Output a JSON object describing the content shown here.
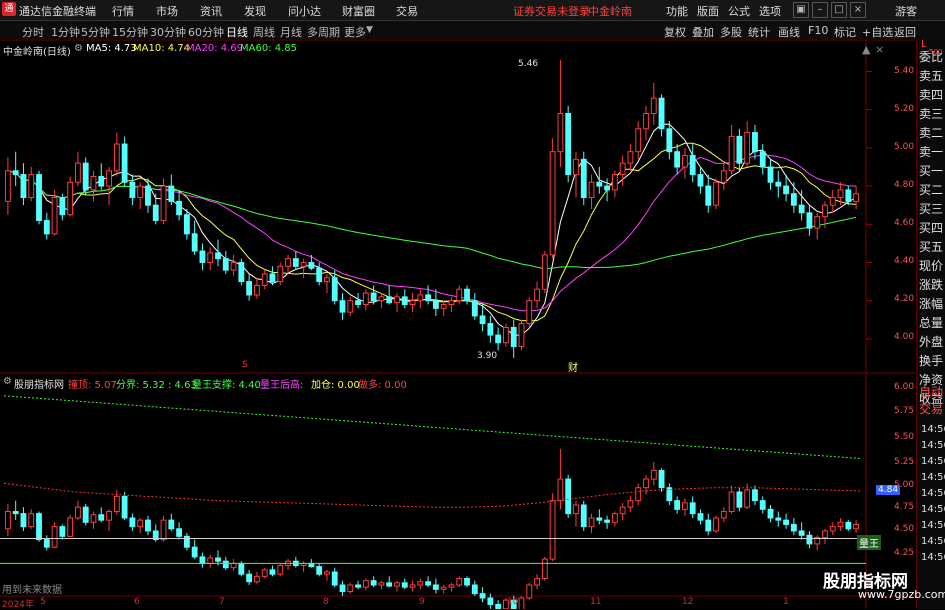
{
  "menubar": {
    "app_title": "通达信金融终端",
    "items": [
      "行情",
      "市场",
      "资讯",
      "发现",
      "问小达",
      "财富圈",
      "交易"
    ],
    "login_notice": "证券交易未登录",
    "stock_short": "中金岭南",
    "controls": [
      "功能",
      "版面",
      "公式",
      "选项"
    ],
    "guest": "游客"
  },
  "periodbar": {
    "periods": [
      "分时",
      "1分钟",
      "5分钟",
      "15分钟",
      "30分钟",
      "60分钟",
      "日线",
      "周线",
      "月线",
      "多周期",
      "更多"
    ],
    "active_index": 6,
    "tools": [
      "复权",
      "叠加",
      "多股",
      "统计",
      "画线",
      "F10",
      "标记",
      "+自选",
      "返回"
    ]
  },
  "main_chart": {
    "stock_title": "中金岭南(日线)",
    "ma_legend": [
      {
        "label": "MA5: 4.73",
        "color": "#ffffff"
      },
      {
        "label": "MA10: 4.74",
        "color": "#ffff40"
      },
      {
        "label": "MA20: 4.69",
        "color": "#ff40ff"
      },
      {
        "label": "MA60: 4.85",
        "color": "#40ff40"
      }
    ],
    "price_axis": [
      "5.40",
      "5.20",
      "5.00",
      "4.80",
      "4.60",
      "4.40",
      "4.20",
      "4.00"
    ],
    "high_marker": "5.46",
    "low_marker": "3.90",
    "event_marker_s": "S",
    "event_marker_cai": "财"
  },
  "indicator": {
    "name": "股朋指标网",
    "legend": [
      {
        "label": "撞顶: 5.07",
        "color": "#ff4040"
      },
      {
        "label": "分界: 5.32 : 4.63",
        "color": "#40ff40"
      },
      {
        "label": "量王支撑: 4.40",
        "color": "#40ff40"
      },
      {
        "label": "量王后高:",
        "color": "#ff40ff"
      },
      {
        "label": "加仓: 0.00",
        "color": "#ffff40"
      },
      {
        "label": "做多: 0.00",
        "color": "#ff4040"
      }
    ],
    "axis": [
      "6.00",
      "5.75",
      "5.50",
      "5.25",
      "5.00",
      "4.75",
      "4.50",
      "4.25"
    ],
    "current_value": "4.84",
    "line_label": "量王",
    "note": "用到未来数据"
  },
  "time_axis": {
    "labels": [
      "2024年",
      "5",
      "6",
      "7",
      "8",
      "9",
      "10",
      "11",
      "12",
      "1"
    ]
  },
  "right_panel": {
    "header_top": "L",
    "header_sub": "500",
    "items": [
      "委比",
      "卖五",
      "卖四",
      "卖三",
      "卖二",
      "卖一",
      "买一",
      "买二",
      "买三",
      "买四",
      "买五",
      "现价",
      "涨跌",
      "涨幅",
      "总量",
      "外盘",
      "换手",
      "净资",
      "收益"
    ],
    "trade_items": [
      "自动",
      "交易"
    ],
    "times": [
      "14:56",
      "14:56",
      "14:56",
      "14:56",
      "14:56",
      "14:56",
      "14:56",
      "14:56",
      "14:56"
    ]
  },
  "watermark": {
    "title": "股朋指标网",
    "url": "www.7gpzb.com"
  },
  "chart_data": {
    "type": "candlestick",
    "price_range": [
      3.9,
      5.46
    ],
    "indicator_range": [
      4.2,
      6.05
    ],
    "candles": [
      [
        4.72,
        4.95,
        4.65,
        4.88
      ],
      [
        4.88,
        4.98,
        4.8,
        4.86
      ],
      [
        4.86,
        4.92,
        4.7,
        4.74
      ],
      [
        4.74,
        4.9,
        4.72,
        4.86
      ],
      [
        4.86,
        4.88,
        4.6,
        4.62
      ],
      [
        4.62,
        4.66,
        4.52,
        4.55
      ],
      [
        4.55,
        4.78,
        4.54,
        4.74
      ],
      [
        4.74,
        4.76,
        4.62,
        4.65
      ],
      [
        4.65,
        4.85,
        4.64,
        4.82
      ],
      [
        4.82,
        4.98,
        4.8,
        4.92
      ],
      [
        4.92,
        4.95,
        4.75,
        4.78
      ],
      [
        4.78,
        4.88,
        4.72,
        4.85
      ],
      [
        4.85,
        4.92,
        4.78,
        4.8
      ],
      [
        4.8,
        4.9,
        4.7,
        4.88
      ],
      [
        4.88,
        5.08,
        4.85,
        5.02
      ],
      [
        5.02,
        5.06,
        4.8,
        4.82
      ],
      [
        4.82,
        4.86,
        4.7,
        4.74
      ],
      [
        4.74,
        4.82,
        4.68,
        4.8
      ],
      [
        4.8,
        4.84,
        4.66,
        4.7
      ],
      [
        4.7,
        4.76,
        4.6,
        4.62
      ],
      [
        4.62,
        4.84,
        4.6,
        4.8
      ],
      [
        4.8,
        4.86,
        4.7,
        4.72
      ],
      [
        4.72,
        4.78,
        4.62,
        4.65
      ],
      [
        4.65,
        4.68,
        4.52,
        4.55
      ],
      [
        4.55,
        4.62,
        4.44,
        4.46
      ],
      [
        4.46,
        4.5,
        4.36,
        4.4
      ],
      [
        4.4,
        4.48,
        4.36,
        4.45
      ],
      [
        4.45,
        4.52,
        4.38,
        4.42
      ],
      [
        4.42,
        4.46,
        4.34,
        4.36
      ],
      [
        4.36,
        4.44,
        4.33,
        4.4
      ],
      [
        4.4,
        4.42,
        4.28,
        4.3
      ],
      [
        4.3,
        4.34,
        4.2,
        4.23
      ],
      [
        4.23,
        4.32,
        4.21,
        4.28
      ],
      [
        4.28,
        4.36,
        4.26,
        4.34
      ],
      [
        4.34,
        4.38,
        4.28,
        4.3
      ],
      [
        4.3,
        4.4,
        4.28,
        4.38
      ],
      [
        4.38,
        4.44,
        4.34,
        4.42
      ],
      [
        4.42,
        4.46,
        4.36,
        4.38
      ],
      [
        4.38,
        4.42,
        4.32,
        4.4
      ],
      [
        4.4,
        4.44,
        4.36,
        4.37
      ],
      [
        4.37,
        4.4,
        4.28,
        4.3
      ],
      [
        4.3,
        4.34,
        4.24,
        4.32
      ],
      [
        4.32,
        4.36,
        4.18,
        4.2
      ],
      [
        4.2,
        4.24,
        4.1,
        4.14
      ],
      [
        4.14,
        4.22,
        4.12,
        4.2
      ],
      [
        4.2,
        4.24,
        4.16,
        4.18
      ],
      [
        4.18,
        4.26,
        4.15,
        4.24
      ],
      [
        4.24,
        4.28,
        4.18,
        4.2
      ],
      [
        4.2,
        4.24,
        4.16,
        4.22
      ],
      [
        4.22,
        4.28,
        4.18,
        4.19
      ],
      [
        4.19,
        4.24,
        4.14,
        4.22
      ],
      [
        4.22,
        4.26,
        4.16,
        4.18
      ],
      [
        4.18,
        4.24,
        4.14,
        4.2
      ],
      [
        4.2,
        4.26,
        4.16,
        4.23
      ],
      [
        4.23,
        4.28,
        4.18,
        4.2
      ],
      [
        4.2,
        4.26,
        4.12,
        4.16
      ],
      [
        4.16,
        4.2,
        4.12,
        4.18
      ],
      [
        4.18,
        4.22,
        4.14,
        4.2
      ],
      [
        4.2,
        4.28,
        4.18,
        4.26
      ],
      [
        4.26,
        4.28,
        4.18,
        4.2
      ],
      [
        4.2,
        4.24,
        4.1,
        4.12
      ],
      [
        4.12,
        4.18,
        4.04,
        4.08
      ],
      [
        4.08,
        4.12,
        3.98,
        4.02
      ],
      [
        4.02,
        4.06,
        3.94,
        3.98
      ],
      [
        3.98,
        4.08,
        3.96,
        4.06
      ],
      [
        4.06,
        4.1,
        3.9,
        3.96
      ],
      [
        3.96,
        4.1,
        3.94,
        4.08
      ],
      [
        4.08,
        4.22,
        4.06,
        4.2
      ],
      [
        4.2,
        4.3,
        4.16,
        4.26
      ],
      [
        4.26,
        4.46,
        4.24,
        4.44
      ],
      [
        4.44,
        5.05,
        4.42,
        4.98
      ],
      [
        4.98,
        5.46,
        4.9,
        5.18
      ],
      [
        5.18,
        5.22,
        4.82,
        4.86
      ],
      [
        4.86,
        4.98,
        4.74,
        4.94
      ],
      [
        4.94,
        4.98,
        4.7,
        4.74
      ],
      [
        4.74,
        4.86,
        4.68,
        4.82
      ],
      [
        4.82,
        4.9,
        4.76,
        4.8
      ],
      [
        4.8,
        4.84,
        4.72,
        4.78
      ],
      [
        4.78,
        4.88,
        4.74,
        4.86
      ],
      [
        4.86,
        4.96,
        4.8,
        4.92
      ],
      [
        4.92,
        5.02,
        4.88,
        4.98
      ],
      [
        4.98,
        5.14,
        4.94,
        5.1
      ],
      [
        5.1,
        5.22,
        5.04,
        5.18
      ],
      [
        5.18,
        5.34,
        5.12,
        5.26
      ],
      [
        5.26,
        5.28,
        5.06,
        5.1
      ],
      [
        5.1,
        5.14,
        4.94,
        4.98
      ],
      [
        4.98,
        5.02,
        4.86,
        4.9
      ],
      [
        4.9,
        5.0,
        4.84,
        4.96
      ],
      [
        4.96,
        5.02,
        4.82,
        4.86
      ],
      [
        4.86,
        4.9,
        4.76,
        4.8
      ],
      [
        4.8,
        4.86,
        4.66,
        4.7
      ],
      [
        4.7,
        4.84,
        4.68,
        4.82
      ],
      [
        4.82,
        4.92,
        4.78,
        4.88
      ],
      [
        4.88,
        5.12,
        4.86,
        5.06
      ],
      [
        5.06,
        5.1,
        4.88,
        4.92
      ],
      [
        4.92,
        5.14,
        4.9,
        5.08
      ],
      [
        5.08,
        5.12,
        4.94,
        4.98
      ],
      [
        4.98,
        5.02,
        4.86,
        4.9
      ],
      [
        4.9,
        4.94,
        4.78,
        4.82
      ],
      [
        4.82,
        4.88,
        4.74,
        4.8
      ],
      [
        4.8,
        4.86,
        4.72,
        4.76
      ],
      [
        4.76,
        4.82,
        4.66,
        4.7
      ],
      [
        4.7,
        4.78,
        4.62,
        4.66
      ],
      [
        4.66,
        4.7,
        4.54,
        4.58
      ],
      [
        4.58,
        4.66,
        4.52,
        4.64
      ],
      [
        4.64,
        4.72,
        4.58,
        4.7
      ],
      [
        4.7,
        4.78,
        4.66,
        4.74
      ],
      [
        4.74,
        4.82,
        4.7,
        4.78
      ],
      [
        4.78,
        4.8,
        4.7,
        4.72
      ],
      [
        4.72,
        4.8,
        4.68,
        4.76
      ]
    ]
  }
}
